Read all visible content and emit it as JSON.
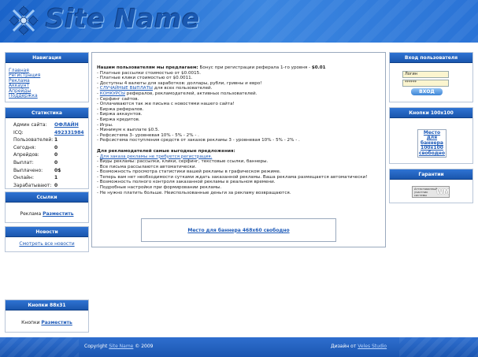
{
  "header": {
    "site_name": "Site Name"
  },
  "nav": {
    "title": "Навигация",
    "items": [
      "Главная",
      "Регистрация",
      "Реклама",
      "Аккаунт",
      "Апрейды",
      "Поддержка"
    ]
  },
  "stats": {
    "title": "Статистика",
    "rows": [
      {
        "label": "Админ сайта:",
        "value": "ОФЛАЙН"
      },
      {
        "label": "ICQ:",
        "value": "492331984"
      },
      {
        "label": "Пользователей:",
        "value": "1"
      },
      {
        "label": "Сегодня:",
        "value": "0"
      },
      {
        "label": "Апрейдов:",
        "value": "0"
      },
      {
        "label": "Выплат:",
        "value": "0"
      },
      {
        "label": "Выплачено:",
        "value": "0$"
      },
      {
        "label": "Онлайн:",
        "value": "1"
      },
      {
        "label": "Зарабатывают:",
        "value": "0"
      }
    ]
  },
  "links": {
    "title": "Ссылки",
    "text": "Реклама",
    "action": "Разместить"
  },
  "news": {
    "title": "Новости",
    "link": "Смотреть все новости"
  },
  "buttons88": {
    "title": "Кнопки 88x31",
    "text": "Кнопки",
    "action": "Разместить"
  },
  "main": {
    "intro_bold": "Нашим пользователям мы предлагаем:",
    "intro_rest": " Бонус при регистрации реферала 1-го уровня - ",
    "intro_bonus": "$0.01",
    "user_items": [
      {
        "pre": "- Платные рассылки стоимостью от $0.0015.",
        "link": "",
        "post": ""
      },
      {
        "pre": "- Платные клики стоимостью от $0.0011.",
        "link": "",
        "post": ""
      },
      {
        "pre": "- Доступны 4 валюты для заработков: доллары, рубли, гривны и евро!",
        "link": "",
        "post": ""
      },
      {
        "pre": "- ",
        "link": "СЛУЧАЙНЫЕ ВЫПЛАТЫ",
        "post": " для всех пользователей."
      },
      {
        "pre": "- ",
        "link": "КОНКУРСЫ",
        "post": " рефералов, рекламодателей, активных пользователей."
      },
      {
        "pre": "- Серфинг сайтов.",
        "link": "",
        "post": ""
      },
      {
        "pre": "- Оплачиваются так же письма с новостями нашего сайта!",
        "link": "",
        "post": ""
      },
      {
        "pre": "- Биржа рефералов.",
        "link": "",
        "post": ""
      },
      {
        "pre": "- Биржа аккаунтов.",
        "link": "",
        "post": ""
      },
      {
        "pre": "- Биржа кредитов.",
        "link": "",
        "post": ""
      },
      {
        "pre": "- Игры.",
        "link": "",
        "post": ""
      },
      {
        "pre": "- Минимум к выплате $0.5.",
        "link": "",
        "post": ""
      },
      {
        "pre": "- Рефсистема 3- уровневая 10% - 5% - 2% - .",
        "link": "",
        "post": ""
      },
      {
        "pre": "- Рефсистема поступления средств от заказов рекламы 3 - уровневая 10% - 5% - 2% - .",
        "link": "",
        "post": ""
      }
    ],
    "adv_title": "Для рекламодателей самые выгодные предложения:",
    "adv_items": [
      {
        "pre": "- ",
        "link": "Для заказа рекламы не требуется регистрация.",
        "post": ""
      },
      {
        "pre": "- Виды рекламы: рассылки, клики, серфинг, текстовые ссылки, баннеры.",
        "link": "",
        "post": ""
      },
      {
        "pre": "- Все письма рассылаются автоматически.",
        "link": "",
        "post": ""
      },
      {
        "pre": "- Возможность просмотра статистики вашей рекламы в графическом режиме.",
        "link": "",
        "post": ""
      },
      {
        "pre": "- Теперь вам нет необходимости сутками ждать заказанной рекламы. Ваша реклама размещается автоматически!",
        "link": "",
        "post": ""
      },
      {
        "pre": "- Возможность полного контроля заказанной рекламы в реальном времени.",
        "link": "",
        "post": ""
      },
      {
        "pre": "- Подробные настройки при формировании рекламы.",
        "link": "",
        "post": ""
      },
      {
        "pre": "- Не нужно платить больше. Неиспользованные деньги за рекламу возвращаются.",
        "link": "",
        "post": ""
      }
    ],
    "banner": "Место для баннера 468x60 свободно"
  },
  "login": {
    "title": "Вход пользователя",
    "login_value": "Логин",
    "password_value": "******",
    "button": "ВХОД"
  },
  "buttons100": {
    "title": "Кнопки 100x100",
    "slot": "Место для баннера 100x100 свободно"
  },
  "guarantee": {
    "title": "Гарантии",
    "badge_line1": "Аттестованный",
    "badge_line2": "участник системы",
    "badge_mark": "WM"
  },
  "footer": {
    "copyright_pre": "Copyright ",
    "copyright_link": "Site Name",
    "copyright_post": " © 2009",
    "design_pre": "Дизайн от ",
    "design_link": "Veles Studio"
  }
}
